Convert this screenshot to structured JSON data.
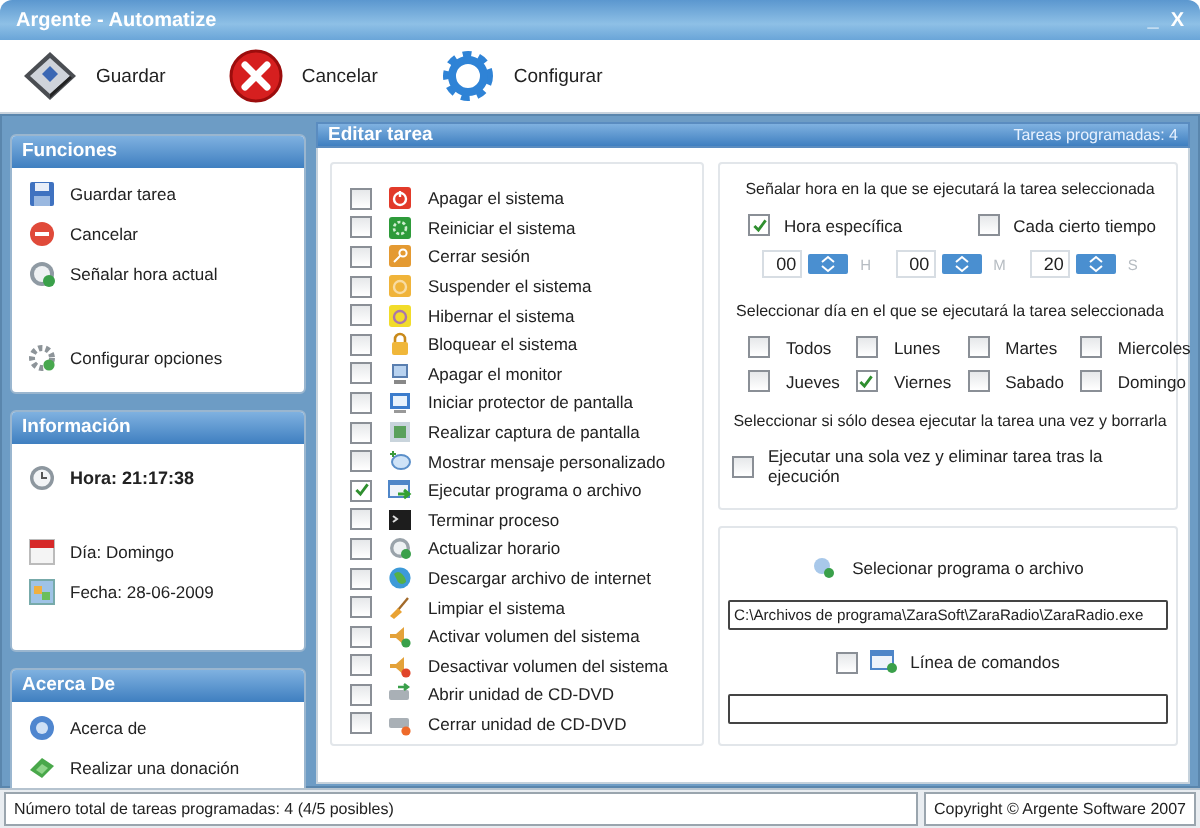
{
  "window": {
    "title": "Argente - Automatize",
    "controls": [
      "_",
      "X"
    ]
  },
  "toolbar": [
    {
      "label": "Guardar"
    },
    {
      "label": "Cancelar"
    },
    {
      "label": "Configurar"
    }
  ],
  "sidebar": [
    {
      "title": "Funciones",
      "items": [
        {
          "label": "Guardar tarea"
        },
        {
          "label": "Cancelar"
        },
        {
          "label": "Señalar hora actual"
        },
        {
          "label": "Configurar opciones"
        }
      ]
    },
    {
      "title": "Información",
      "items": [
        {
          "label": "Hora: 21:17:38"
        },
        {
          "label": "Día: Domingo"
        },
        {
          "label": "Fecha: 28-06-2009"
        }
      ]
    },
    {
      "title": "Acerca De",
      "items": [
        {
          "label": "Acerca de"
        },
        {
          "label": "Realizar una donación"
        }
      ]
    }
  ],
  "editor": {
    "title": "Editar tarea",
    "count": "Tareas programadas: 4",
    "tasks": [
      {
        "label": "Apagar el sistema",
        "checked": false
      },
      {
        "label": "Reiniciar el sistema",
        "checked": false
      },
      {
        "label": "Cerrar sesión",
        "checked": false
      },
      {
        "label": "Suspender el sistema",
        "checked": false
      },
      {
        "label": "Hibernar el sistema",
        "checked": false
      },
      {
        "label": "Bloquear el sistema",
        "checked": false
      },
      {
        "label": "Apagar el monitor",
        "checked": false
      },
      {
        "label": "Iniciar protector de pantalla",
        "checked": false
      },
      {
        "label": "Realizar captura de pantalla",
        "checked": false
      },
      {
        "label": "Mostrar mensaje personalizado",
        "checked": false
      },
      {
        "label": "Ejecutar programa o archivo",
        "checked": true
      },
      {
        "label": "Terminar proceso",
        "checked": false
      },
      {
        "label": "Actualizar horario",
        "checked": false
      },
      {
        "label": "Descargar archivo de internet",
        "checked": false
      },
      {
        "label": "Limpiar el sistema",
        "checked": false
      },
      {
        "label": "Activar volumen del sistema",
        "checked": false
      },
      {
        "label": "Desactivar volumen del sistema",
        "checked": false
      },
      {
        "label": "Abrir unidad de CD-DVD",
        "checked": false
      },
      {
        "label": "Cerrar unidad de CD-DVD",
        "checked": false
      }
    ],
    "schedule": {
      "time_heading": "Señalar hora en la que se ejecutará la tarea seleccionada",
      "modes": [
        {
          "label": "Hora específica",
          "checked": true
        },
        {
          "label": "Cada cierto tiempo",
          "checked": false
        }
      ],
      "time": [
        {
          "value": "00",
          "unit": "H"
        },
        {
          "value": "00",
          "unit": "M"
        },
        {
          "value": "20",
          "unit": "S"
        }
      ],
      "day_heading": "Seleccionar día en el que se ejecutará la tarea seleccionada",
      "days": [
        {
          "label": "Todos",
          "checked": false
        },
        {
          "label": "Lunes",
          "checked": false
        },
        {
          "label": "Martes",
          "checked": false
        },
        {
          "label": "Miercoles",
          "checked": false
        },
        {
          "label": "Jueves",
          "checked": false
        },
        {
          "label": "Viernes",
          "checked": true
        },
        {
          "label": "Sabado",
          "checked": false
        },
        {
          "label": "Domingo",
          "checked": false
        }
      ],
      "once_heading": "Seleccionar si sólo desea ejecutar la tarea una vez y borrarla",
      "once": {
        "label": "Ejecutar una sola vez y eliminar tarea tras la ejecución",
        "checked": false
      }
    },
    "program": {
      "label": "Selecionar programa o archivo",
      "path": "C:\\Archivos de programa\\ZaraSoft\\ZaraRadio\\ZaraRadio.exe",
      "command_line": {
        "label": "Línea de comandos",
        "checked": false
      }
    }
  },
  "status_bar": {
    "left": "Número total de tareas programadas: 4 (4/5 posibles)",
    "right": "Copyright © Argente Software 2007"
  }
}
